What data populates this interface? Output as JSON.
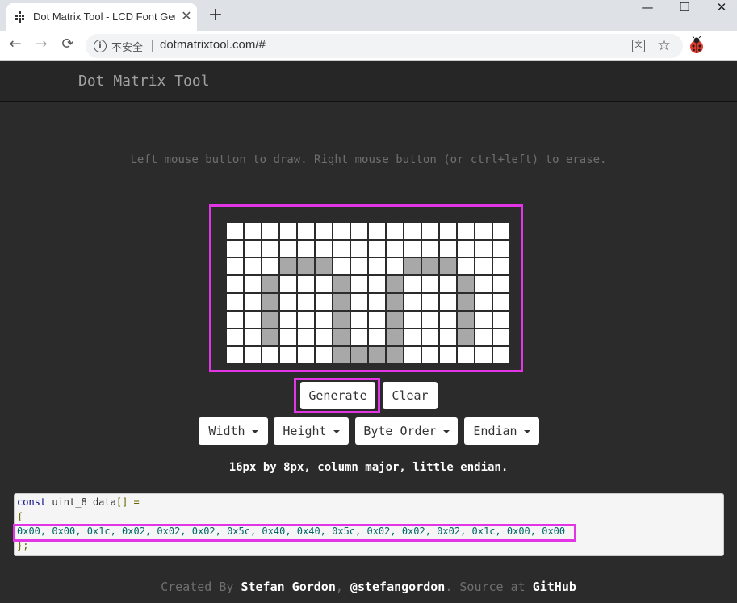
{
  "browser": {
    "tab_title": "Dot Matrix Tool - LCD Font Generator",
    "close_glyph": "✕",
    "new_tab_glyph": "+",
    "window_controls": {
      "minimize": "—",
      "maximize": "☐",
      "close": "✕"
    },
    "nav": {
      "back": "←",
      "forward": "→",
      "reload": "⟳"
    },
    "security_label": "不安全",
    "url": "dotmatrixtool.com/#",
    "icons": [
      "dot-matrix-favicon-icon",
      "info-icon",
      "translate-icon",
      "star-icon",
      "ladybug-extension-icon"
    ]
  },
  "site": {
    "brand": "Dot Matrix Tool"
  },
  "instructions": "Left mouse button to draw. Right mouse button (or ctrl+left) to erase.",
  "matrix": {
    "columns": 16,
    "rows": 8,
    "filled": [
      [
        2,
        3
      ],
      [
        2,
        4
      ],
      [
        2,
        5
      ],
      [
        3,
        2
      ],
      [
        4,
        2
      ],
      [
        5,
        2
      ],
      [
        6,
        2
      ],
      [
        3,
        6
      ],
      [
        4,
        6
      ],
      [
        5,
        6
      ],
      [
        6,
        6
      ],
      [
        7,
        6
      ],
      [
        7,
        7
      ],
      [
        7,
        8
      ],
      [
        7,
        9
      ],
      [
        6,
        9
      ],
      [
        5,
        9
      ],
      [
        4,
        9
      ],
      [
        3,
        9
      ],
      [
        2,
        10
      ],
      [
        2,
        11
      ],
      [
        2,
        12
      ],
      [
        3,
        13
      ],
      [
        4,
        13
      ],
      [
        5,
        13
      ],
      [
        6,
        13
      ]
    ]
  },
  "buttons": {
    "generate": "Generate",
    "clear": "Clear"
  },
  "dropdowns": {
    "width": "Width",
    "height": "Height",
    "byte_order": "Byte Order",
    "endian": "Endian"
  },
  "summary": "16px by 8px, column major, little endian.",
  "code": {
    "line1": {
      "keyword": "const",
      "type": "uint_8",
      "name": "data",
      "punct": "[] ="
    },
    "line2": "{",
    "line3": "0x00, 0x00, 0x1c, 0x02, 0x02, 0x02, 0x5c, 0x40, 0x40, 0x5c, 0x02, 0x02, 0x02, 0x1c, 0x00, 0x00",
    "line4": "};"
  },
  "footer": {
    "created_by": "Created By",
    "author": "Stefan Gordon",
    "comma": ",",
    "handle": "@stefangordon",
    "source_at": ". Source at",
    "github": "GitHub"
  },
  "colors": {
    "highlight": "#e135e6",
    "page_bg": "#2b2b2b",
    "cell_on": "#a8a8a8",
    "cell_off": "#ffffff"
  }
}
